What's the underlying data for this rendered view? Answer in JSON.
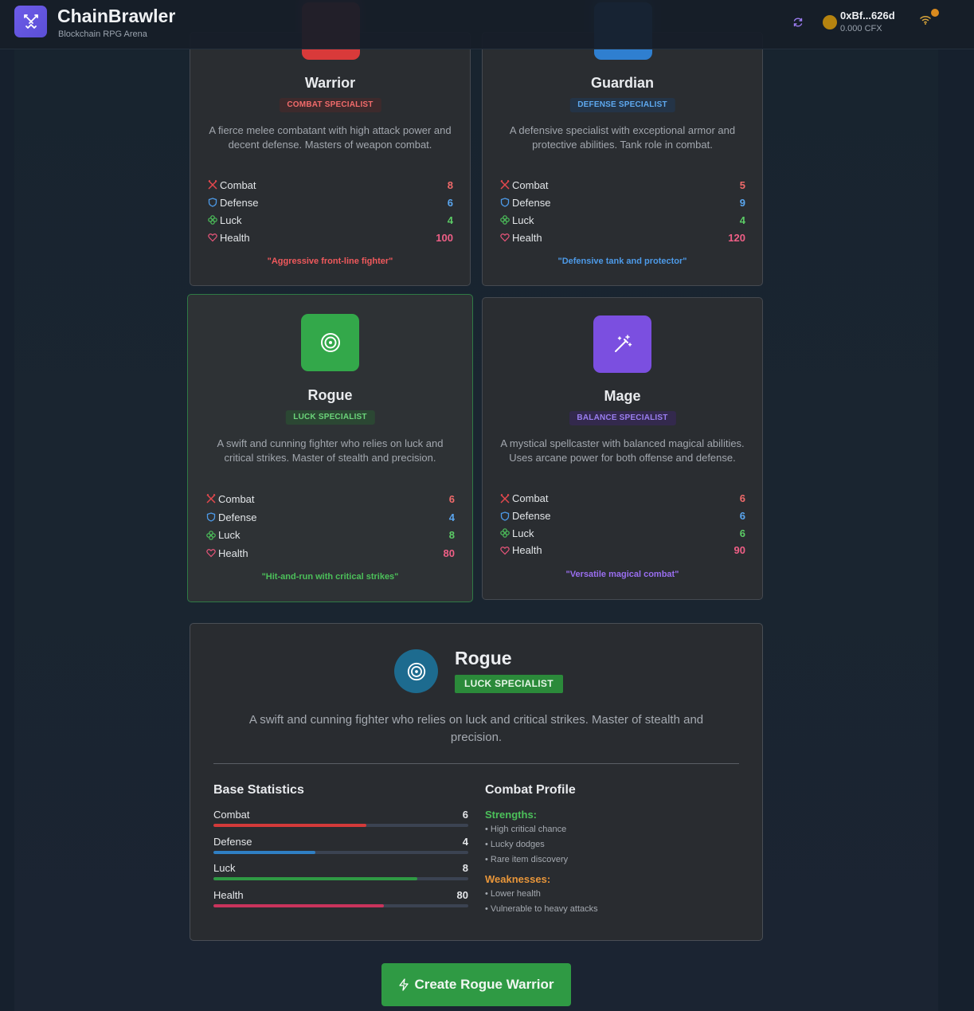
{
  "app": {
    "title": "ChainBrawler",
    "subtitle": "Blockchain RPG Arena"
  },
  "wallet": {
    "address": "0xBf...626d",
    "balance": "0.000 CFX"
  },
  "colors": {
    "combat": "#e5484d",
    "defense": "#4d9ae8",
    "luck": "#4cc05a",
    "health": "#e8557a",
    "warrior": "#d93a3a",
    "guardian": "#2f7fd0",
    "rogue": "#33a84a",
    "mage": "#7b4fe0"
  },
  "classes": [
    {
      "name": "Warrior",
      "badge": "COMBAT SPECIALIST",
      "description": "A fierce melee combatant with high attack power and decent defense. Masters of weapon combat.",
      "stats": [
        {
          "label": "Combat",
          "value": "8"
        },
        {
          "label": "Defense",
          "value": "6"
        },
        {
          "label": "Luck",
          "value": "4"
        },
        {
          "label": "Health",
          "value": "100"
        }
      ],
      "quote": "\"Aggressive front-line fighter\"",
      "icon": "sword-icon"
    },
    {
      "name": "Guardian",
      "badge": "DEFENSE SPECIALIST",
      "description": "A defensive specialist with exceptional armor and protective abilities. Tank role in combat.",
      "stats": [
        {
          "label": "Combat",
          "value": "5"
        },
        {
          "label": "Defense",
          "value": "9"
        },
        {
          "label": "Luck",
          "value": "4"
        },
        {
          "label": "Health",
          "value": "120"
        }
      ],
      "quote": "\"Defensive tank and protector\"",
      "icon": "shield-icon"
    },
    {
      "name": "Rogue",
      "badge": "LUCK SPECIALIST",
      "description": "A swift and cunning fighter who relies on luck and critical strikes. Master of stealth and precision.",
      "stats": [
        {
          "label": "Combat",
          "value": "6"
        },
        {
          "label": "Defense",
          "value": "4"
        },
        {
          "label": "Luck",
          "value": "8"
        },
        {
          "label": "Health",
          "value": "80"
        }
      ],
      "quote": "\"Hit-and-run with critical strikes\"",
      "icon": "target-icon"
    },
    {
      "name": "Mage",
      "badge": "BALANCE SPECIALIST",
      "description": "A mystical spellcaster with balanced magical abilities. Uses arcane power for both offense and defense.",
      "stats": [
        {
          "label": "Combat",
          "value": "6"
        },
        {
          "label": "Defense",
          "value": "6"
        },
        {
          "label": "Luck",
          "value": "6"
        },
        {
          "label": "Health",
          "value": "90"
        }
      ],
      "quote": "\"Versatile magical combat\"",
      "icon": "wand-icon"
    }
  ],
  "selected": {
    "name": "Rogue",
    "badge": "LUCK SPECIALIST",
    "description": "A swift and cunning fighter who relies on luck and critical strikes. Master of stealth and precision.",
    "base_title": "Base Statistics",
    "bars": [
      {
        "label": "Combat",
        "value": "6",
        "fill_fraction": 0.6
      },
      {
        "label": "Defense",
        "value": "4",
        "fill_fraction": 0.4
      },
      {
        "label": "Luck",
        "value": "8",
        "fill_fraction": 0.8
      },
      {
        "label": "Health",
        "value": "80",
        "fill_fraction": 0.67
      }
    ],
    "profile_title": "Combat Profile",
    "strengths_title": "Strengths:",
    "strengths": [
      "• High critical chance",
      "• Lucky dodges",
      "• Rare item discovery"
    ],
    "weaknesses_title": "Weaknesses:",
    "weaknesses": [
      "• Lower health",
      "• Vulnerable to heavy attacks"
    ]
  },
  "create_button": "Create Rogue Warrior"
}
